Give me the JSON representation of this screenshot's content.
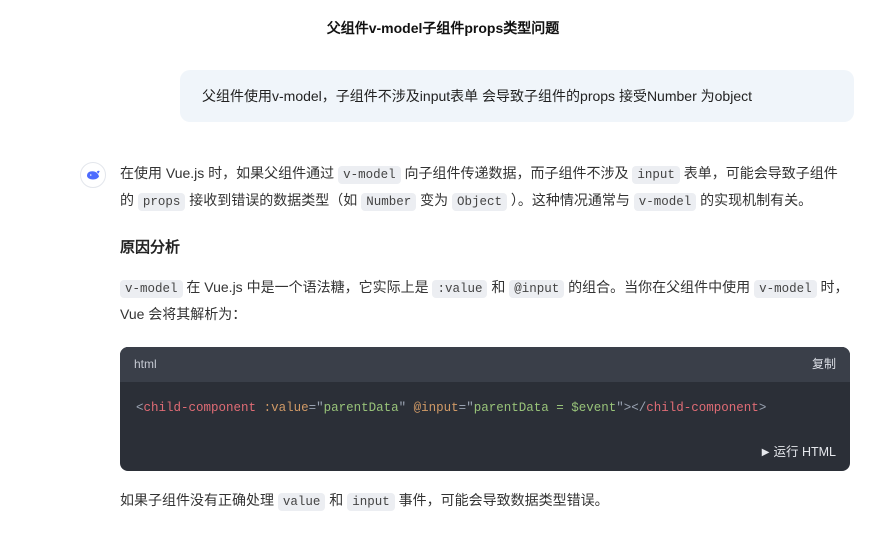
{
  "title": "父组件v-model子组件props类型问题",
  "question": "父组件使用v-model，子组件不涉及input表单 会导致子组件的props  接受Number 为object",
  "answer": {
    "para1": {
      "t0": "在使用 Vue.js 时，如果父组件通过 ",
      "c0": "v-model",
      "t1": " 向子组件传递数据，而子组件不涉及 ",
      "c1": "input",
      "t2": " 表单，可能会导致子组件的 ",
      "c2": "props",
      "t3": " 接收到错误的数据类型（如 ",
      "c3": "Number",
      "t4": " 变为 ",
      "c4": "Object",
      "t5": " ）。这种情况通常与 ",
      "c5": "v-model",
      "t6": " 的实现机制有关。"
    },
    "heading1": "原因分析",
    "para2": {
      "c0": "v-model",
      "t0": " 在 Vue.js 中是一个语法糖，它实际上是 ",
      "c1": ":value",
      "t1": " 和 ",
      "c2": "@input",
      "t2": " 的组合。当你在父组件中使用 ",
      "c3": "v-model",
      "t3": " 时，Vue 会将其解析为："
    },
    "codeblock": {
      "lang": "html",
      "copy": "复制",
      "run": "运行 HTML",
      "syntax": {
        "p0": "<",
        "tag0": "child-component",
        "sp0": " ",
        "attr0": ":value",
        "eq0": "=",
        "q0a": "\"",
        "str0": "parentData",
        "q0b": "\"",
        "sp1": " ",
        "attr1": "@input",
        "eq1": "=",
        "q1a": "\"",
        "str1": "parentData = $event",
        "q1b": "\"",
        "p1": ">",
        "p2": "</",
        "tag1": "child-component",
        "p3": ">"
      }
    },
    "para3": {
      "t0": "如果子组件没有正确处理 ",
      "c0": "value",
      "t1": " 和 ",
      "c1": "input",
      "t2": " 事件，可能会导致数据类型错误。"
    }
  }
}
